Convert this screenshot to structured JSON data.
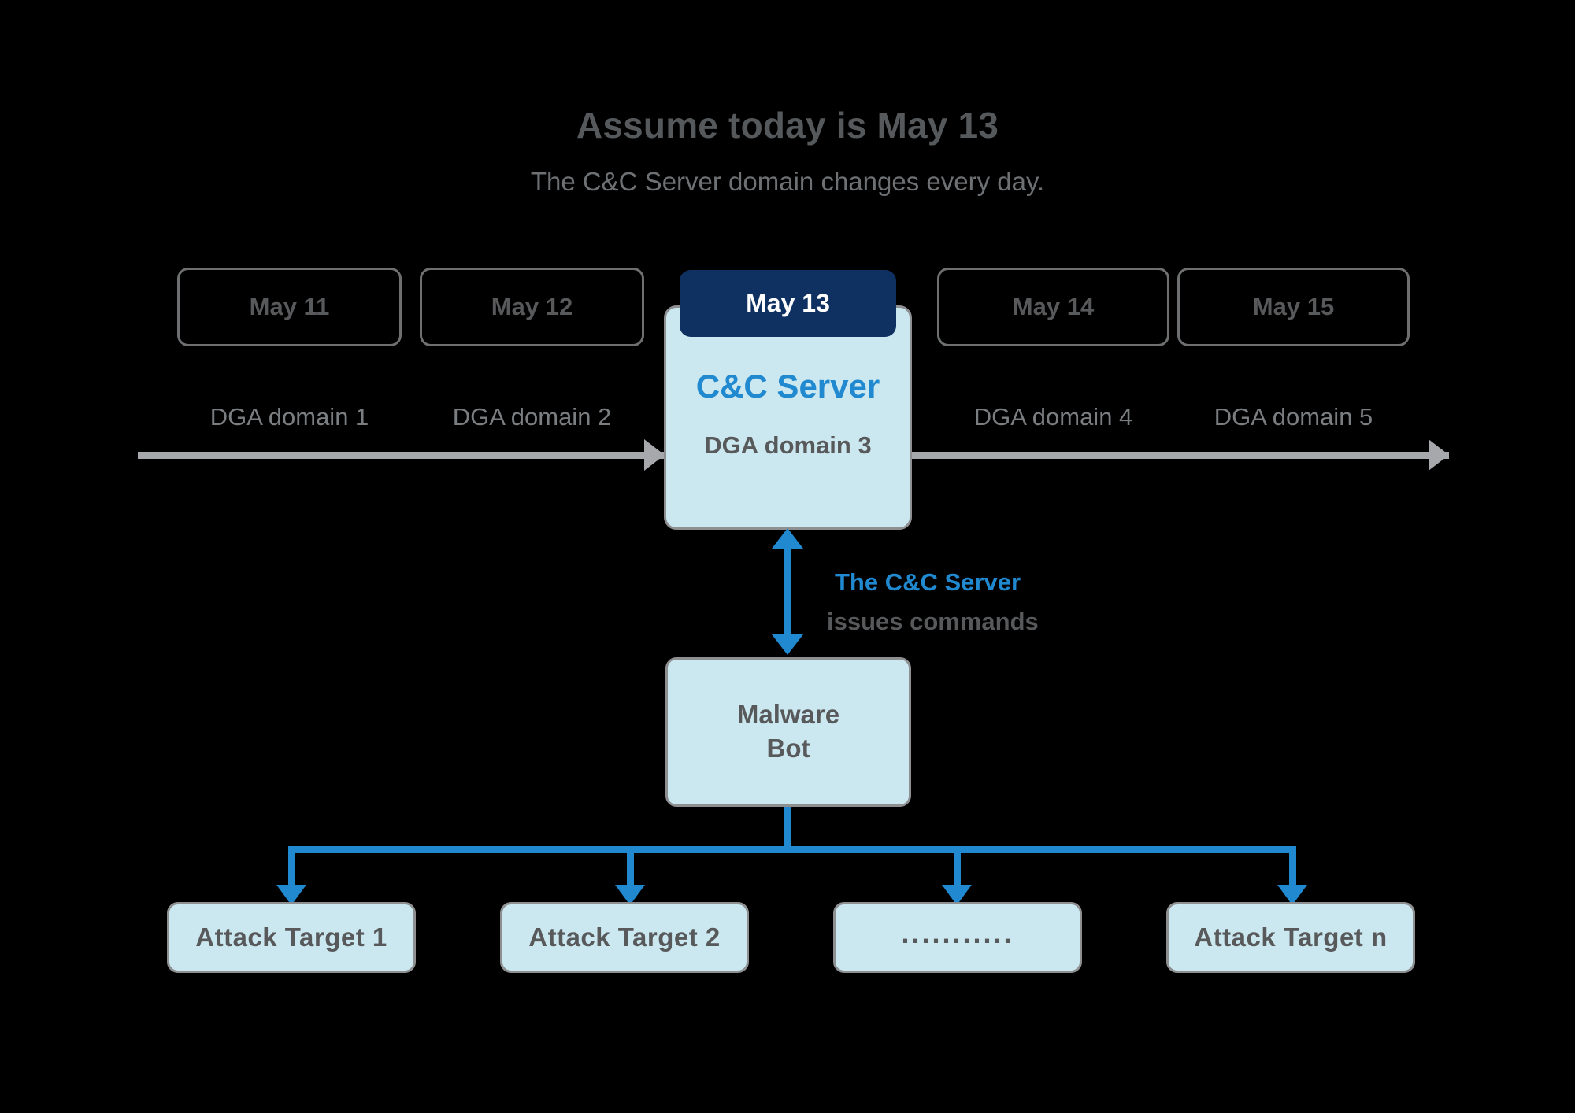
{
  "header": {
    "title": "Assume today is May 13",
    "subtitle": "The C&C Server domain changes every day."
  },
  "colors": {
    "background": "#000000",
    "accent_blue": "#2089d0",
    "badge_navy": "#0f3162",
    "card_fill": "#cbe7ef",
    "card_border": "#8d8f91",
    "timeline_gray": "#a6a8ab",
    "text_gray": "#58595b",
    "label_gray": "#7b7e81"
  },
  "timeline": {
    "days": [
      {
        "label": "May 11",
        "highlighted": false
      },
      {
        "label": "May 12",
        "highlighted": false
      },
      {
        "label": "May 13",
        "highlighted": true
      },
      {
        "label": "May 14",
        "highlighted": false
      },
      {
        "label": "May 15",
        "highlighted": false
      }
    ],
    "domain_labels": [
      "DGA domain 1",
      "DGA domain 2",
      "DGA domain 4",
      "DGA domain 5"
    ]
  },
  "cc_server": {
    "badge": "May 13",
    "title": "C&C Server",
    "domain": "DGA domain 3"
  },
  "command_link": {
    "line1": "The C&C Server",
    "line2": "issues commands"
  },
  "bot": {
    "line1": "Malware",
    "line2": "Bot"
  },
  "targets": [
    {
      "label": "Attack Target 1"
    },
    {
      "label": "Attack Target 2"
    },
    {
      "label": "..........."
    },
    {
      "label": "Attack Target n"
    }
  ]
}
